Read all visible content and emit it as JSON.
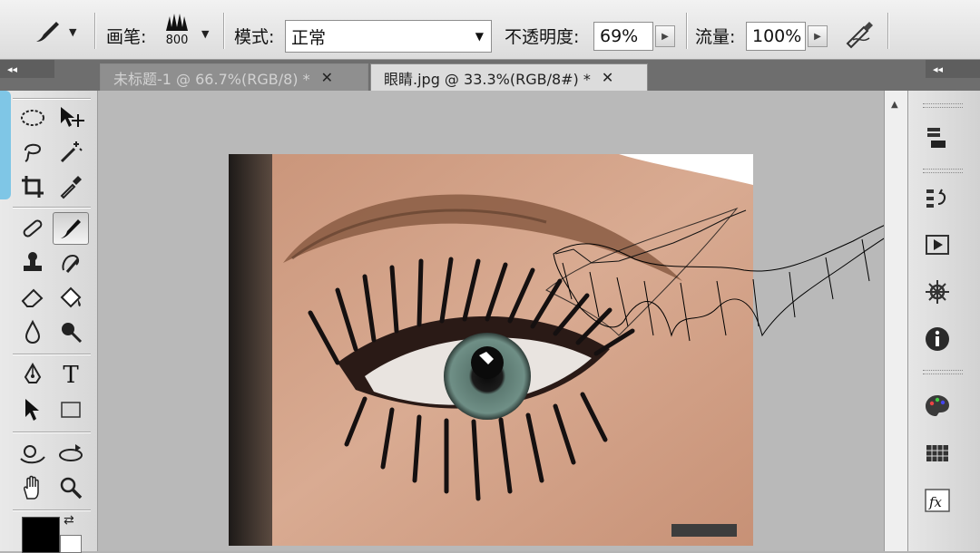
{
  "options": {
    "brush_label": "画笔:",
    "brush_size": "800",
    "mode_label": "模式:",
    "mode_value": "正常",
    "opacity_label": "不透明度:",
    "opacity_value": "69%",
    "flow_label": "流量:",
    "flow_value": "100%"
  },
  "tabs": [
    {
      "label": "未标题-1 @ 66.7%(RGB/8) *",
      "close": "✕"
    },
    {
      "label": "眼睛.jpg @ 33.3%(RGB/8#) *",
      "close": "✕"
    }
  ],
  "collapse": {
    "left": "◂◂",
    "right": "◂◂"
  },
  "tools": {
    "type_label": "T"
  },
  "colors": {
    "accent": "#7fc6e6",
    "foreground": "#000000",
    "background": "#ffffff"
  }
}
